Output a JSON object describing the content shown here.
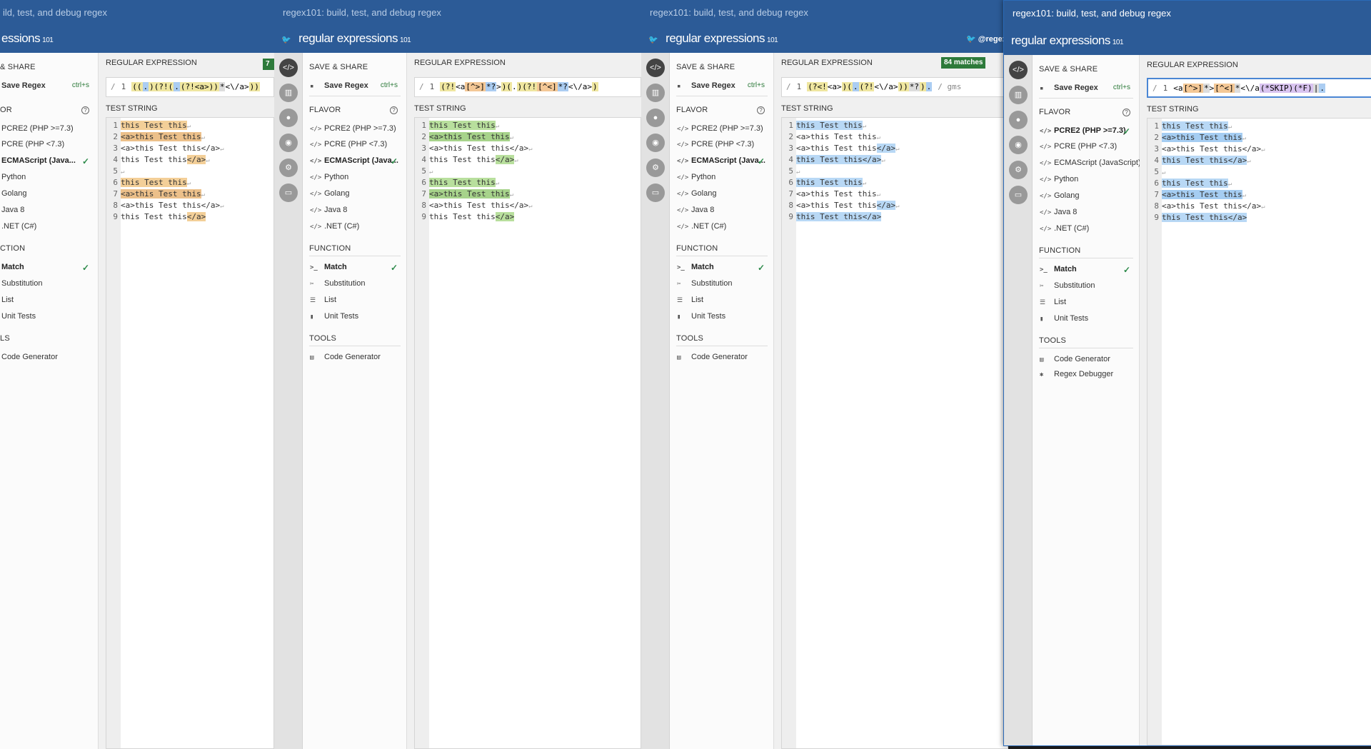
{
  "app_title": "regex101: build, test, and debug regex",
  "logo_text": "regular expressions",
  "logo_sup": "101",
  "twitter": "@regex",
  "windows": [
    {
      "title": "regex101: build, test, and debug regex",
      "flavor_selected": "ECMAScript (JavaScript)",
      "match_count": "7",
      "regex_display": "((.)(?!(.(?!<a>))*<\\/a>))",
      "flags": ""
    },
    {
      "title": "regex101: build, test, and debug regex",
      "flavor_selected": "ECMAScript (JavaScript)",
      "regex_display": "(?!<a[^>]*?>)(.)(?![^<]*?<\\/a>)",
      "flags": ""
    },
    {
      "title": "regex101: build, test, and debug regex",
      "flavor_selected": "ECMAScript (JavaScript)",
      "match_count": "84 matches",
      "regex_display": "(?<!<a>)(.(?!<\\/a>))*?).",
      "flags": "/ gms"
    },
    {
      "title": "regex101: build, test, and debug regex",
      "flavor_selected": "PCRE2 (PHP >=7.3)",
      "regex_display": "<a[^>]*>[^<]*<\\/a(*SKIP)(*F)|.",
      "flags": ""
    }
  ],
  "sidebar": {
    "save_share": "SAVE & SHARE",
    "save_regex": "Save Regex",
    "shortcut": "ctrl+s",
    "flavor_heading": "FLAVOR",
    "help": "?",
    "flavors_short": [
      "PCRE2 (PHP >=7.3)",
      "PCRE (PHP <7.3)",
      "ECMAScript (Java...",
      "Python",
      "Golang",
      "Java 8",
      ".NET (C#)"
    ],
    "flavors_full": [
      "PCRE2 (PHP >=7.3)",
      "PCRE (PHP <7.3)",
      "ECMAScript (JavaScript)",
      "Python",
      "Golang",
      "Java 8",
      ".NET (C#)"
    ],
    "function_heading": "FUNCTION",
    "functions": [
      "Match",
      "Substitution",
      "List",
      "Unit Tests"
    ],
    "tools_heading": "TOOLS",
    "tools": [
      "Code Generator",
      "Regex Debugger"
    ],
    "w1_sections": {
      "save": "& SHARE",
      "flavor": "OR",
      "function": "CTION",
      "tools": "LS"
    },
    "w1_flavors": [
      "PCRE2 (PHP >=7.3)",
      "PCRE (PHP <7.3)",
      "ECMAScript (Java...",
      "Python",
      "Golang",
      "Java 8",
      ".NET (C#)"
    ]
  },
  "main": {
    "regex_label": "REGULAR EXPRESSION",
    "test_label": "TEST STRING",
    "delim": "/",
    "line_no": "1"
  },
  "test_string": [
    "this Test this",
    "<a>this Test this",
    "<a>this Test this</a>",
    "this Test this</a>",
    "",
    "this Test this",
    "<a>this Test this",
    "<a>this Test this</a>",
    "this Test this</a>"
  ],
  "line_numbers": [
    "1",
    "2",
    "3",
    "4",
    "5",
    "6",
    "7",
    "8",
    "9"
  ],
  "w1_clip": {
    "title": "ild, test, and debug regex",
    "logo": "essions"
  },
  "icon_bar": [
    "code-icon",
    "library-icon",
    "user-icon",
    "community-icon",
    "settings-icon",
    "chat-icon"
  ]
}
